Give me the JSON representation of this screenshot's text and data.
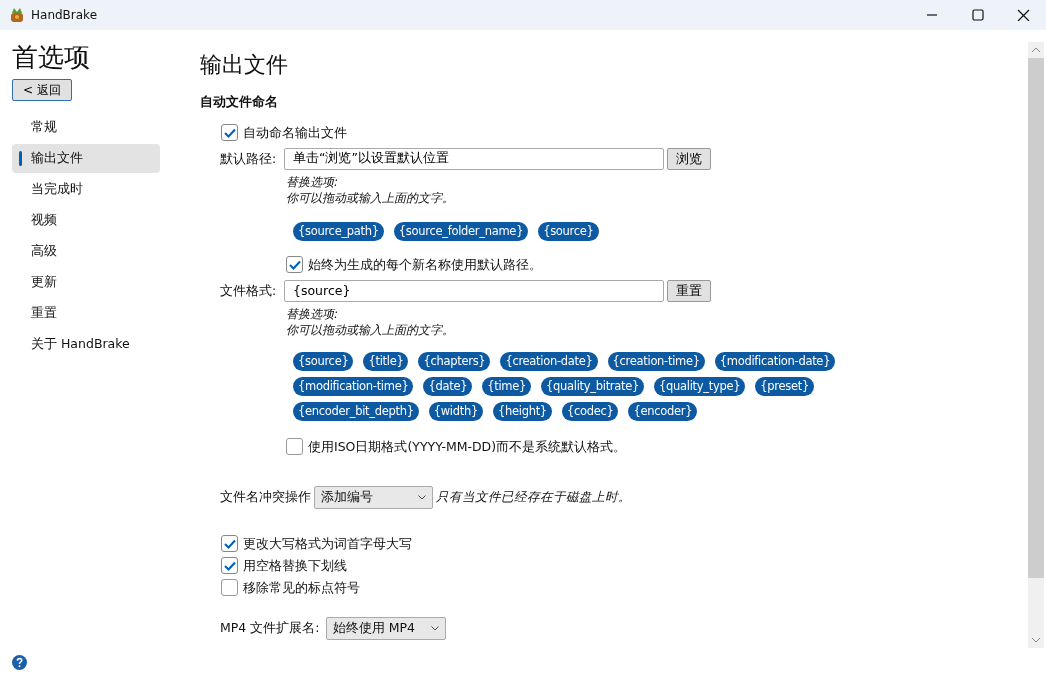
{
  "window": {
    "title": "HandBrake"
  },
  "sidebar": {
    "heading": "首选项",
    "back_button": "< 返回",
    "items": [
      {
        "label": "常规",
        "selected": false
      },
      {
        "label": "输出文件",
        "selected": true
      },
      {
        "label": "当完成时",
        "selected": false
      },
      {
        "label": "视频",
        "selected": false
      },
      {
        "label": "高级",
        "selected": false
      },
      {
        "label": "更新",
        "selected": false
      },
      {
        "label": "重置",
        "selected": false
      },
      {
        "label": "关于 HandBrake",
        "selected": false
      }
    ]
  },
  "main": {
    "title": "输出文件",
    "section": "自动文件命名",
    "auto_name": {
      "label": "自动命名输出文件",
      "checked": true
    },
    "default_path": {
      "label": "默认路径:",
      "value": "单击“浏览”以设置默认位置",
      "button": "浏览",
      "hint_title": "替换选项:",
      "hint_text": "你可以拖动或输入上面的文字。",
      "tokens": [
        "{source_path}",
        "{source_folder_name}",
        "{source}"
      ]
    },
    "always_default": {
      "label": "始终为生成的每个新名称使用默认路径。",
      "checked": true
    },
    "file_format": {
      "label": "文件格式:",
      "value": "{source}",
      "button": "重置",
      "hint_title": "替换选项:",
      "hint_text": "你可以拖动或输入上面的文字。",
      "tokens": [
        "{source}",
        "{title}",
        "{chapters}",
        "{creation-date}",
        "{creation-time}",
        "{modification-date}",
        "{modification-time}",
        "{date}",
        "{time}",
        "{quality_bitrate}",
        "{quality_type}",
        "{preset}",
        "{encoder_bit_depth}",
        "{width}",
        "{height}",
        "{codec}",
        "{encoder}"
      ]
    },
    "iso_date": {
      "label": "使用ISO日期格式(YYYY-MM-DD)而不是系统默认格式。",
      "checked": false
    },
    "conflict": {
      "label": "文件名冲突操作",
      "value": "添加编号",
      "note": "只有当文件已经存在于磁盘上时。"
    },
    "options": [
      {
        "label": "更改大写格式为词首字母大写",
        "checked": true
      },
      {
        "label": "用空格替换下划线",
        "checked": true
      },
      {
        "label": "移除常见的标点符号",
        "checked": false
      }
    ],
    "mp4": {
      "label": "MP4 文件扩展名:",
      "value": "始终使用 MP4"
    }
  }
}
